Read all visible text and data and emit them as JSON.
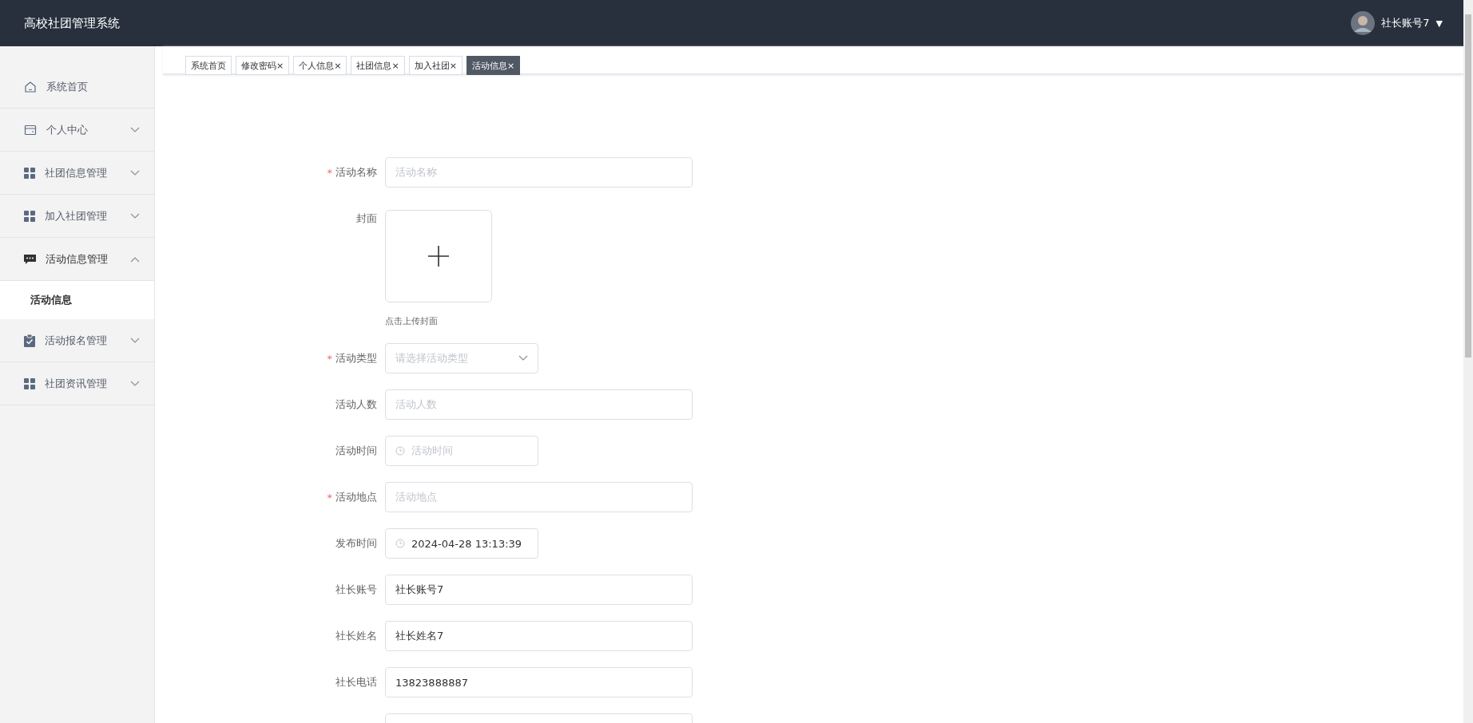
{
  "header": {
    "title": "高校社团管理系统",
    "user": {
      "name": "社长账号7",
      "caret": "▼"
    }
  },
  "sidebar": {
    "items": [
      {
        "label": "系统首页",
        "kind": "home"
      },
      {
        "label": "个人中心",
        "kind": "wallet",
        "expanded": false
      },
      {
        "label": "社团信息管理",
        "kind": "grid",
        "expanded": false
      },
      {
        "label": "加入社团管理",
        "kind": "grid",
        "expanded": false
      },
      {
        "label": "活动信息管理",
        "kind": "chat",
        "expanded": true,
        "children": [
          {
            "label": "活动信息",
            "selected": true
          }
        ]
      },
      {
        "label": "活动报名管理",
        "kind": "clipboard",
        "expanded": false
      },
      {
        "label": "社团资讯管理",
        "kind": "grid",
        "expanded": false
      }
    ]
  },
  "tabs": [
    {
      "label": "系统首页",
      "selected": false
    },
    {
      "label": "修改密码",
      "close": "×",
      "selected": false
    },
    {
      "label": "个人信息",
      "close": "×",
      "selected": false
    },
    {
      "label": "社团信息",
      "close": "×",
      "selected": false
    },
    {
      "label": "加入社团",
      "close": "×",
      "selected": false
    },
    {
      "label": "活动信息",
      "close": "×",
      "selected": true
    }
  ],
  "form": {
    "fields": [
      {
        "kind": "input",
        "label": "活动名称",
        "required_mark": "*",
        "placeholder": "活动名称"
      },
      {
        "kind": "upload",
        "label": "封面",
        "hint": "点击上传封面"
      },
      {
        "kind": "select",
        "label": "活动类型",
        "required_mark": "*",
        "placeholder": "请选择活动类型"
      },
      {
        "kind": "input",
        "label": "活动人数",
        "placeholder": "活动人数"
      },
      {
        "kind": "time",
        "label": "活动时间",
        "placeholder": "活动时间"
      },
      {
        "kind": "input",
        "label": "活动地点",
        "required_mark": "*",
        "placeholder": "活动地点"
      },
      {
        "kind": "time",
        "label": "发布时间",
        "value": "2024-04-28 13:13:39"
      },
      {
        "kind": "input",
        "label": "社长账号",
        "value": "社长账号7"
      },
      {
        "kind": "input",
        "label": "社长姓名",
        "value": "社长姓名7"
      },
      {
        "kind": "input",
        "label": "社长电话",
        "value": "13823888887"
      },
      {
        "kind": "input"
      }
    ]
  }
}
